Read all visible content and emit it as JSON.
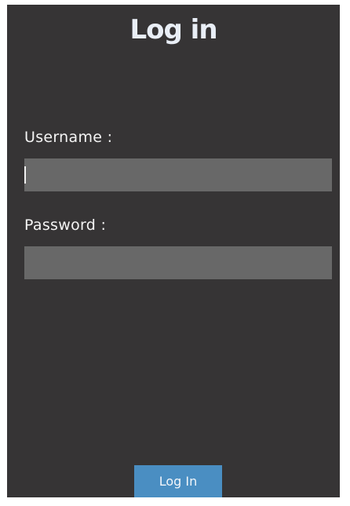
{
  "form": {
    "title": "Log in",
    "username_label": "Username :",
    "password_label": "Password :",
    "username_value": "",
    "password_value": "",
    "submit_label": "Log In"
  },
  "colors": {
    "background": "#363435",
    "input_background": "#686868",
    "button_background": "#4a8ec2",
    "text": "#f2f2f2"
  }
}
